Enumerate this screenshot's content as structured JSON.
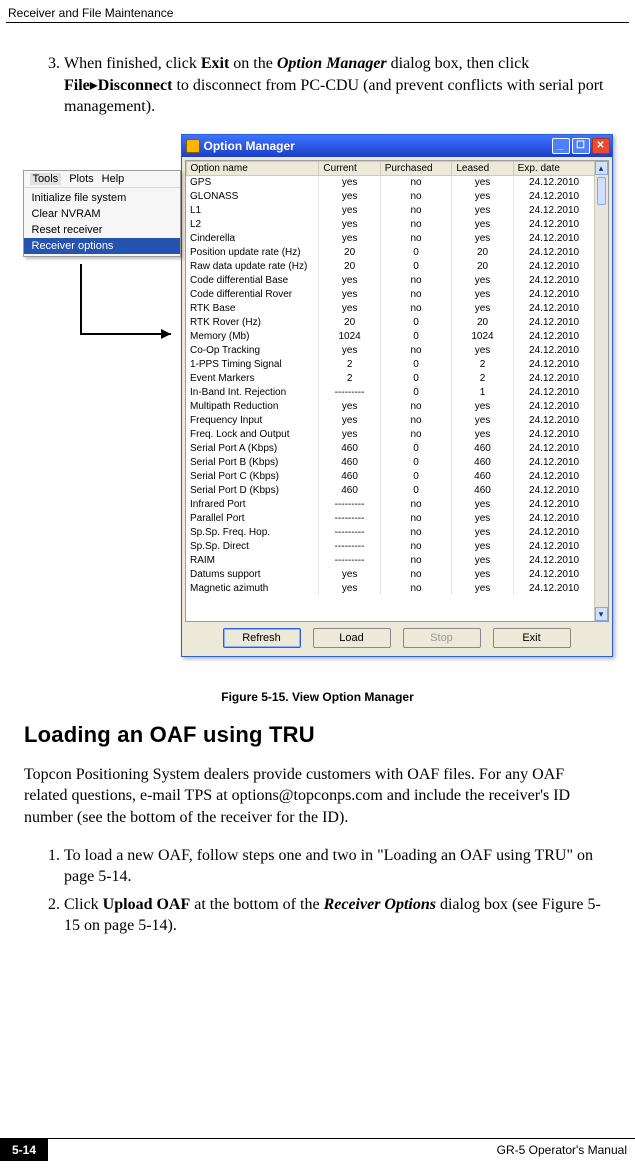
{
  "running_head": "Receiver and File Maintenance",
  "step3": {
    "prefix": "When finished, click ",
    "b1": "Exit",
    "mid1": " on the ",
    "bi1": "Option Manager",
    "mid2": " dialog box, then click ",
    "b2": "File",
    "arrow": "▸",
    "b3": "Disconnect",
    "suffix": " to disconnect from PC-CDU (and prevent conflicts with serial port management)."
  },
  "menu": {
    "bar": [
      "Tools",
      "Plots",
      "Help"
    ],
    "items": [
      "Initialize file system",
      "Clear NVRAM",
      "Reset receiver",
      "Receiver options"
    ]
  },
  "win": {
    "title": "Option Manager",
    "columns": [
      "Option name",
      "Current",
      "Purchased",
      "Leased",
      "Exp. date"
    ],
    "rows": [
      [
        "GPS",
        "yes",
        "no",
        "yes",
        "24.12.2010"
      ],
      [
        "GLONASS",
        "yes",
        "no",
        "yes",
        "24.12.2010"
      ],
      [
        "L1",
        "yes",
        "no",
        "yes",
        "24.12.2010"
      ],
      [
        "L2",
        "yes",
        "no",
        "yes",
        "24.12.2010"
      ],
      [
        "Cinderella",
        "yes",
        "no",
        "yes",
        "24.12.2010"
      ],
      [
        "Position update rate (Hz)",
        "20",
        "0",
        "20",
        "24.12.2010"
      ],
      [
        "Raw data update rate (Hz)",
        "20",
        "0",
        "20",
        "24.12.2010"
      ],
      [
        "Code differential Base",
        "yes",
        "no",
        "yes",
        "24.12.2010"
      ],
      [
        "Code differential Rover",
        "yes",
        "no",
        "yes",
        "24.12.2010"
      ],
      [
        "RTK Base",
        "yes",
        "no",
        "yes",
        "24.12.2010"
      ],
      [
        "RTK Rover (Hz)",
        "20",
        "0",
        "20",
        "24.12.2010"
      ],
      [
        "Memory (Mb)",
        "1024",
        "0",
        "1024",
        "24.12.2010"
      ],
      [
        "Co-Op Tracking",
        "yes",
        "no",
        "yes",
        "24.12.2010"
      ],
      [
        "1-PPS Timing Signal",
        "2",
        "0",
        "2",
        "24.12.2010"
      ],
      [
        "Event Markers",
        "2",
        "0",
        "2",
        "24.12.2010"
      ],
      [
        "In-Band Int. Rejection",
        "---------",
        "0",
        "1",
        "24.12.2010"
      ],
      [
        "Multipath Reduction",
        "yes",
        "no",
        "yes",
        "24.12.2010"
      ],
      [
        "Frequency Input",
        "yes",
        "no",
        "yes",
        "24.12.2010"
      ],
      [
        "Freq. Lock and Output",
        "yes",
        "no",
        "yes",
        "24.12.2010"
      ],
      [
        "Serial Port A (Kbps)",
        "460",
        "0",
        "460",
        "24.12.2010"
      ],
      [
        "Serial Port B (Kbps)",
        "460",
        "0",
        "460",
        "24.12.2010"
      ],
      [
        "Serial Port C (Kbps)",
        "460",
        "0",
        "460",
        "24.12.2010"
      ],
      [
        "Serial Port D (Kbps)",
        "460",
        "0",
        "460",
        "24.12.2010"
      ],
      [
        "Infrared Port",
        "---------",
        "no",
        "yes",
        "24.12.2010"
      ],
      [
        "Parallel Port",
        "---------",
        "no",
        "yes",
        "24.12.2010"
      ],
      [
        "Sp.Sp. Freq. Hop.",
        "---------",
        "no",
        "yes",
        "24.12.2010"
      ],
      [
        "Sp.Sp. Direct",
        "---------",
        "no",
        "yes",
        "24.12.2010"
      ],
      [
        "RAIM",
        "---------",
        "no",
        "yes",
        "24.12.2010"
      ],
      [
        "Datums support",
        "yes",
        "no",
        "yes",
        "24.12.2010"
      ],
      [
        "Magnetic azimuth",
        "yes",
        "no",
        "yes",
        "24.12.2010"
      ]
    ],
    "buttons": {
      "refresh": "Refresh",
      "load": "Load",
      "stop": "Stop",
      "exit": "Exit"
    }
  },
  "figure_caption": "Figure 5-15. View Option Manager",
  "heading": "Loading an OAF using TRU",
  "para": "Topcon Positioning System dealers provide customers with OAF files. For any OAF related questions, e-mail TPS at options@topconps.com and include the receiver's ID number (see the bottom of the receiver for the ID).",
  "step_a": "To load a new OAF, follow steps one and two in \"Loading an OAF using TRU\" on page 5-14.",
  "step_b": {
    "prefix": "Click ",
    "b1": "Upload OAF",
    "mid1": " at the bottom of the ",
    "bi1": "Receiver Options",
    "suffix": " dialog box (see Figure 5-15 on page 5-14)."
  },
  "footer": {
    "page": "5-14",
    "manual": "GR-5 Operator's Manual"
  }
}
